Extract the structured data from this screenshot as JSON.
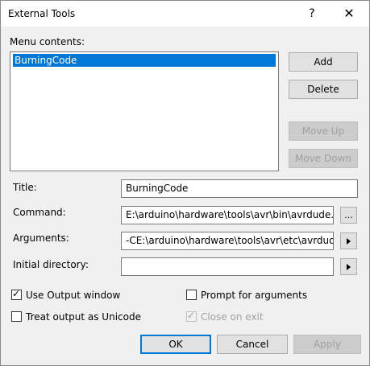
{
  "window": {
    "title": "External Tools",
    "help_glyph": "?",
    "close_glyph": "✕"
  },
  "menu_contents": {
    "label": "Menu contents:",
    "items": [
      "BurningCode"
    ],
    "selected_index": 0
  },
  "side_buttons": {
    "add": "Add",
    "delete": "Delete",
    "move_up": "Move Up",
    "move_down": "Move Down"
  },
  "form": {
    "title_label": "Title:",
    "title_value": "BurningCode",
    "command_label": "Command:",
    "command_value": "E:\\arduino\\hardware\\tools\\avr\\bin\\avrdude.exe",
    "browse_glyph": "...",
    "arguments_label": "Arguments:",
    "arguments_value": "-CE:\\arduino\\hardware\\tools\\avr\\etc\\avrdude.conf",
    "initial_dir_label": "Initial directory:",
    "initial_dir_value": ""
  },
  "options": {
    "use_output_window": {
      "label": "Use Output window",
      "checked": true
    },
    "prompt_for_arguments": {
      "label": "Prompt for arguments",
      "checked": false
    },
    "treat_output_as_unicode": {
      "label": "Treat output as Unicode",
      "checked": false
    },
    "close_on_exit": {
      "label": "Close on exit",
      "checked": true,
      "disabled": true
    }
  },
  "footer": {
    "ok": "OK",
    "cancel": "Cancel",
    "apply": "Apply"
  },
  "colors": {
    "accent": "#0078d7",
    "dialog_bg": "#f0f0f0"
  }
}
